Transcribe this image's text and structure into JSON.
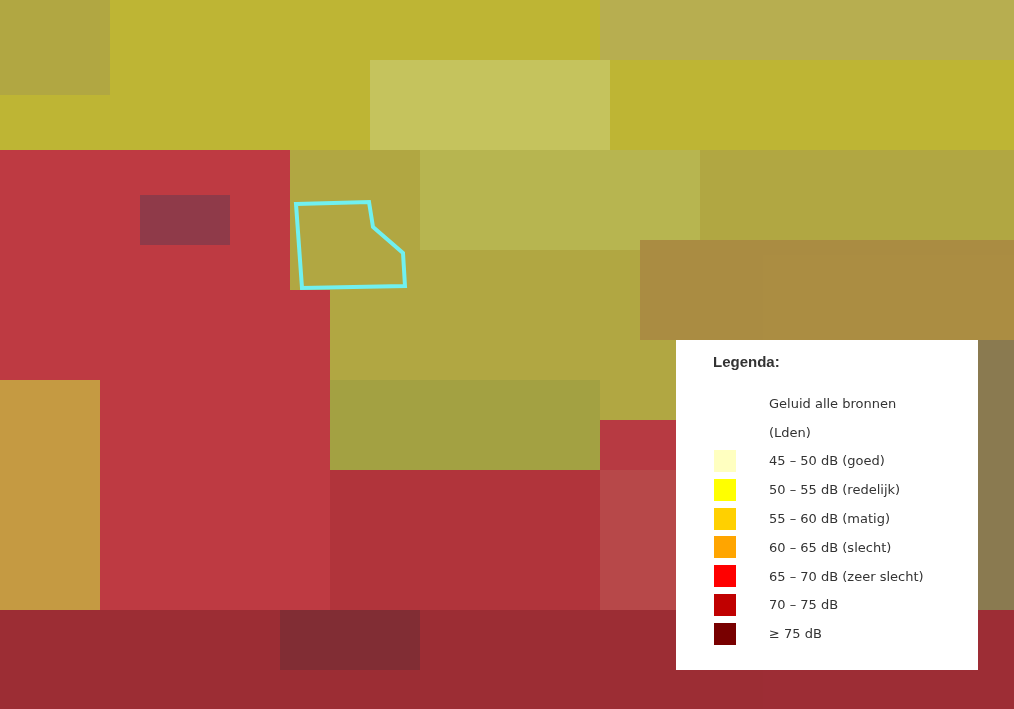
{
  "legend": {
    "title": "Legenda:",
    "layer_name": "Geluid alle bronnen",
    "layer_unit": "(Lden)",
    "items": [
      {
        "label": "45 – 50 dB (goed)",
        "color": "#ffffc0"
      },
      {
        "label": "50 – 55 dB (redelijk)",
        "color": "#ffff00"
      },
      {
        "label": "55 – 60 dB (matig)",
        "color": "#ffd000"
      },
      {
        "label": "60 – 65 dB (slecht)",
        "color": "#ffa500"
      },
      {
        "label": "65 – 70 dB (zeer slecht)",
        "color": "#ff0000"
      },
      {
        "label": "70 – 75 dB",
        "color": "#c00000"
      },
      {
        "label": "≥ 75 dB",
        "color": "#780000"
      }
    ]
  }
}
